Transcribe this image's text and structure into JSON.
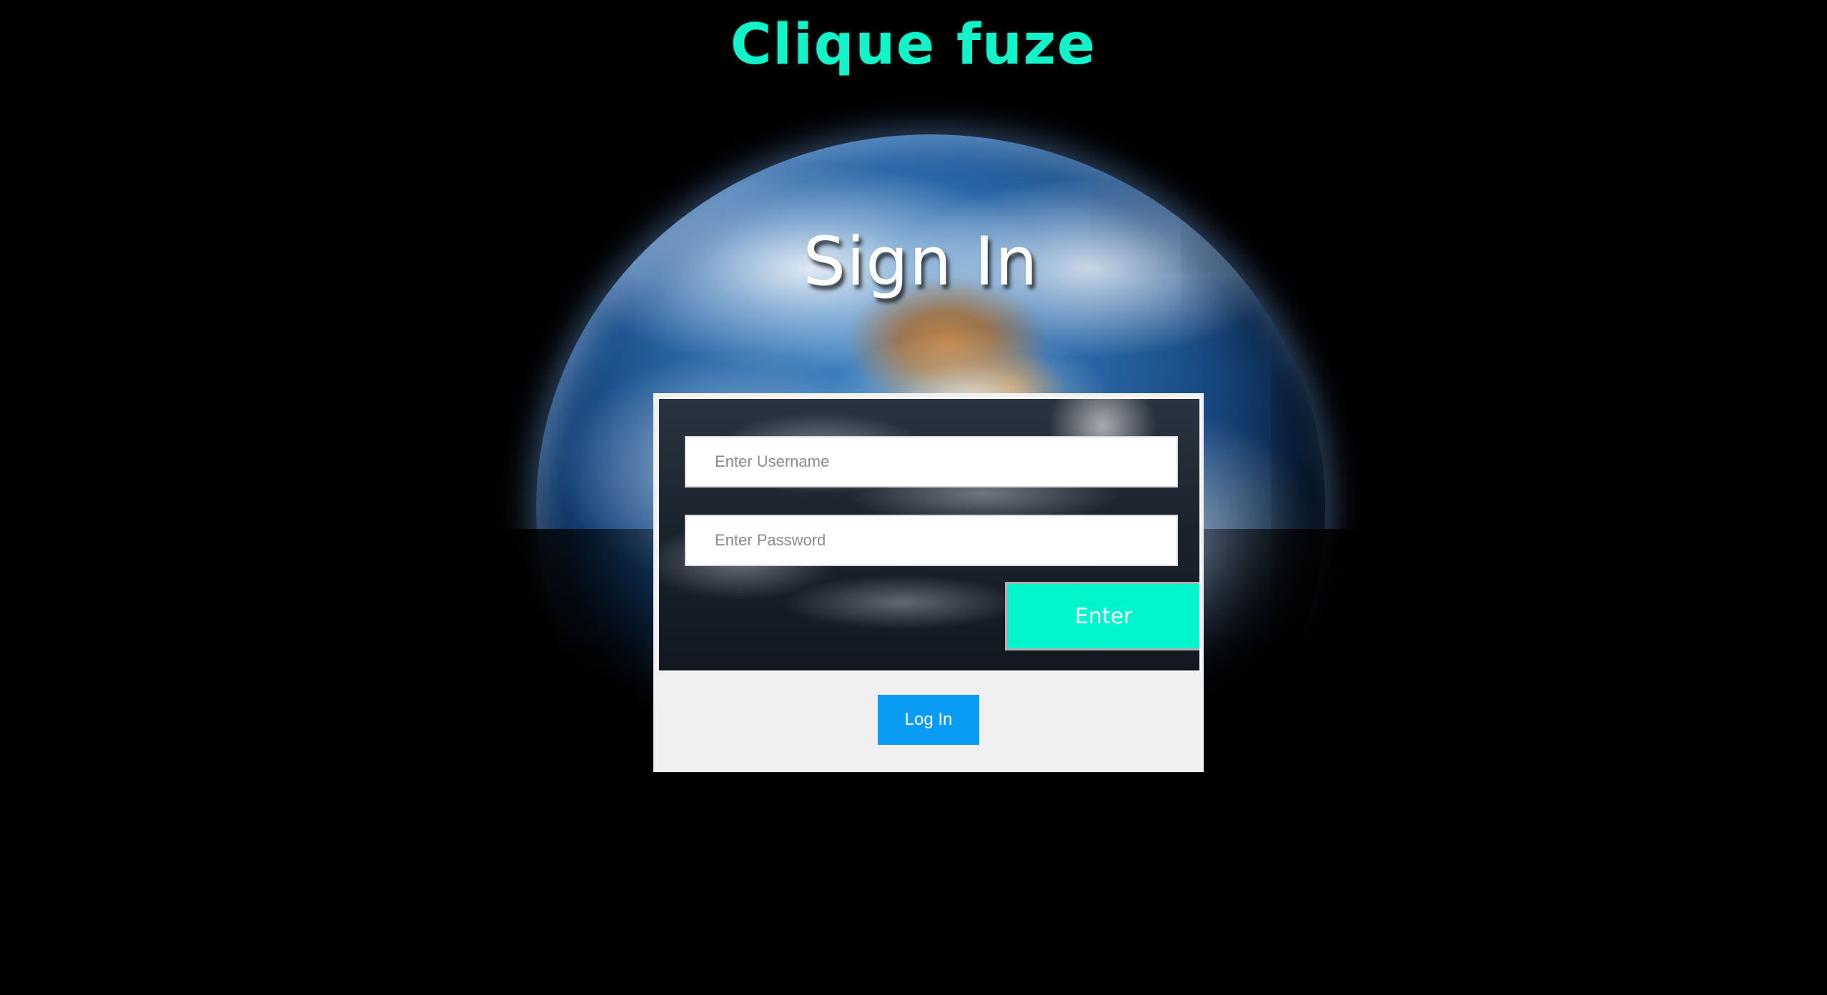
{
  "brand": {
    "title": "Clique fuze",
    "color": "#13f2c8"
  },
  "signin": {
    "heading": "Sign In"
  },
  "form": {
    "username_placeholder": "Enter Username",
    "password_placeholder": "Enter Password",
    "enter_label": "Enter",
    "enter_color": "#00f5cc"
  },
  "footer": {
    "login_label": "Log In",
    "login_color": "#0a9cf5"
  },
  "background": {
    "image": "earth-globe"
  }
}
